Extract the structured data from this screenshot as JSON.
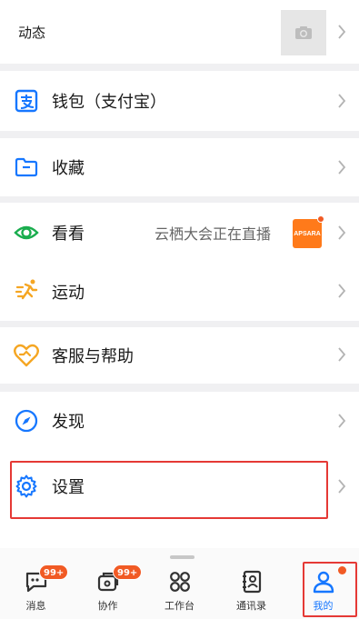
{
  "top_row": {
    "label": "动态"
  },
  "menu": {
    "wallet": {
      "label": "钱包（支付宝）"
    },
    "favorites": {
      "label": "收藏"
    },
    "watch": {
      "label": "看看",
      "extra": "云栖大会正在直播",
      "thumb_text": "APSARA"
    },
    "sport": {
      "label": "运动"
    },
    "support": {
      "label": "客服与帮助"
    },
    "discover": {
      "label": "发现"
    },
    "settings": {
      "label": "设置"
    }
  },
  "tabbar": {
    "tabs": [
      {
        "label": "消息",
        "badge": "99+"
      },
      {
        "label": "协作",
        "badge": "99+"
      },
      {
        "label": "工作台"
      },
      {
        "label": "通讯录"
      },
      {
        "label": "我的"
      }
    ]
  },
  "colors": {
    "accent_blue": "#1677ff",
    "badge_orange": "#f15a24",
    "highlight_red": "#e53935",
    "green": "#1aad4e",
    "orange": "#f5a623"
  }
}
